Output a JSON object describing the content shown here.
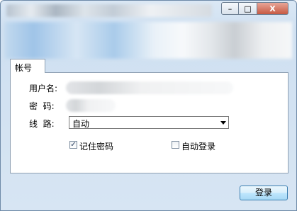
{
  "window": {
    "controls": {
      "minimize": "–",
      "maximize": "□",
      "close": "X"
    }
  },
  "tabs": [
    {
      "label": "帐号"
    }
  ],
  "form": {
    "username_label": "用户名:",
    "password_label": "密  码:",
    "route_label": "线  路:",
    "route_selected": "自动",
    "remember_label": "记住密码",
    "remember_checked": true,
    "remember_mark": "✓",
    "autologin_label": "自动登录",
    "autologin_checked": false
  },
  "login_button": "登录",
  "icons": {
    "minimize": "minimize-icon",
    "maximize": "maximize-icon",
    "close": "close-icon",
    "dropdown": "chevron-down-icon",
    "checkmark": "checkmark-icon"
  }
}
